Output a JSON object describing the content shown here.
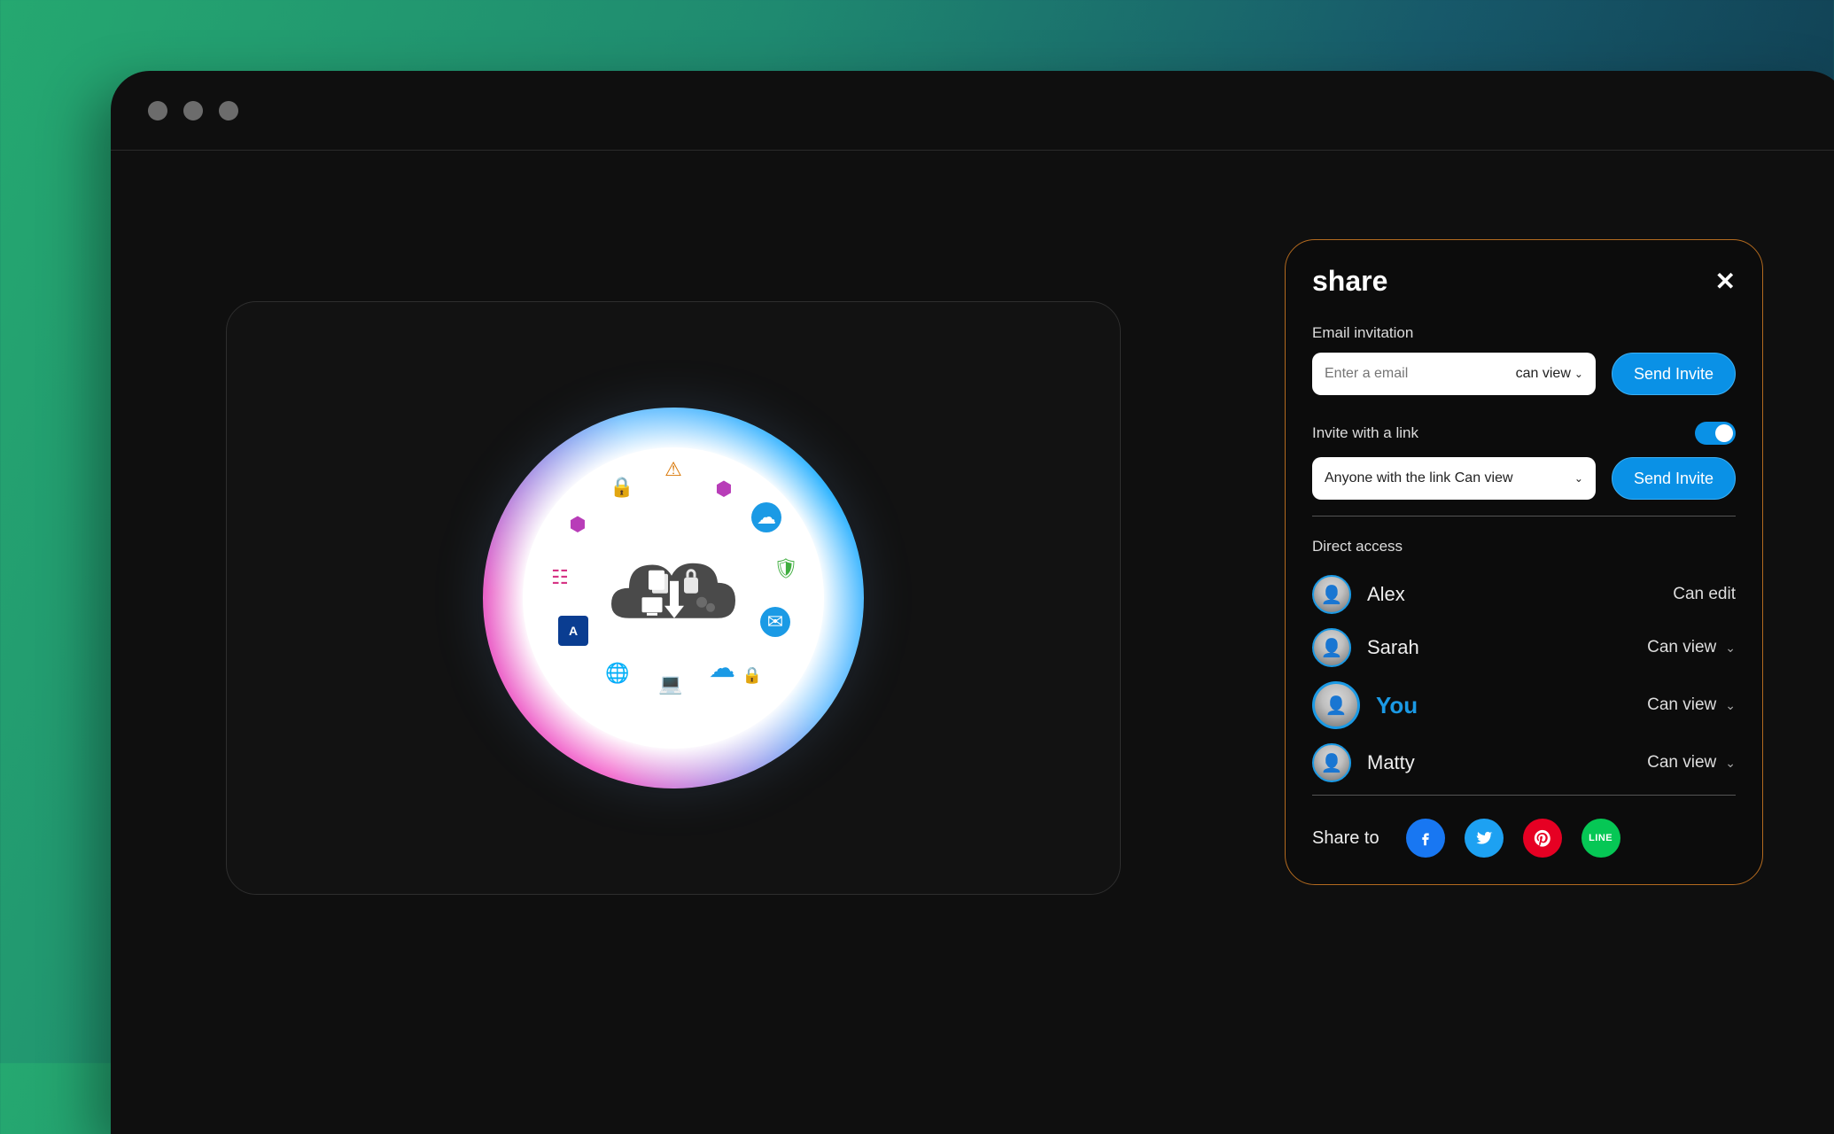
{
  "share": {
    "title": "share",
    "email_invitation_label": "Email invitation",
    "email_placeholder": "Enter a email",
    "email_permission": "can view",
    "send_invite_label": "Send Invite",
    "invite_link_label": "Invite with a link",
    "link_toggle_on": true,
    "link_permission_text": "Anyone with the link Can view",
    "direct_access_label": "Direct access",
    "people": [
      {
        "name": "Alex",
        "permission": "Can edit",
        "has_dropdown": false,
        "is_you": false
      },
      {
        "name": "Sarah",
        "permission": "Can view",
        "has_dropdown": true,
        "is_you": false
      },
      {
        "name": "You",
        "permission": "Can view",
        "has_dropdown": true,
        "is_you": true
      },
      {
        "name": "Matty",
        "permission": "Can view",
        "has_dropdown": true,
        "is_you": false
      }
    ],
    "share_to_label": "Share to",
    "socials": [
      {
        "id": "facebook",
        "glyph": "f"
      },
      {
        "id": "twitter",
        "glyph": "t"
      },
      {
        "id": "pinterest",
        "glyph": "p"
      },
      {
        "id": "line",
        "glyph": "LINE"
      }
    ]
  }
}
